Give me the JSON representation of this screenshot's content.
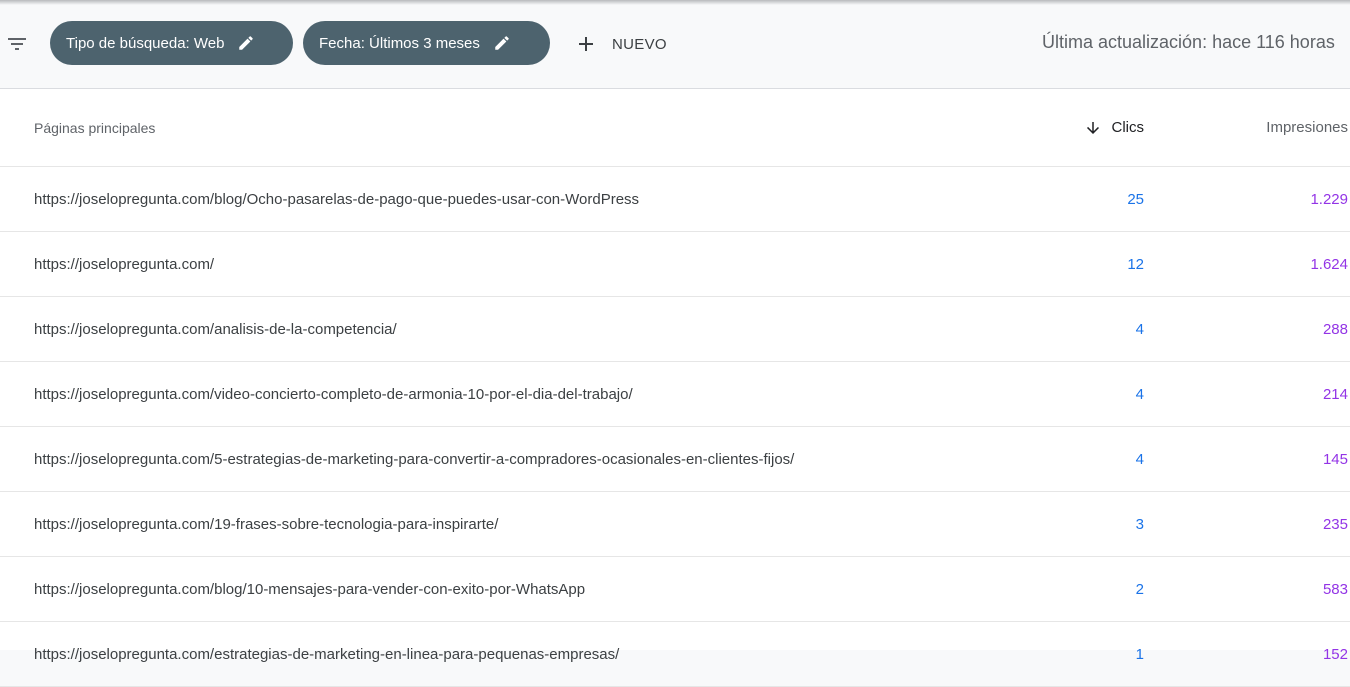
{
  "toolbar": {
    "filters": [
      {
        "label": "Tipo de búsqueda: Web"
      },
      {
        "label": "Fecha: Últimos 3 meses"
      }
    ],
    "add_label": "NUEVO",
    "last_update": "Última actualización: hace 116 horas"
  },
  "table": {
    "headers": {
      "page": "Páginas principales",
      "clicks": "Clics",
      "impressions": "Impresiones"
    },
    "sort": {
      "column": "clicks",
      "direction": "descending"
    },
    "rows": [
      {
        "url": "https://joselopregunta.com/blog/Ocho-pasarelas-de-pago-que-puedes-usar-con-WordPress",
        "clicks": "25",
        "impressions": "1.229"
      },
      {
        "url": "https://joselopregunta.com/",
        "clicks": "12",
        "impressions": "1.624"
      },
      {
        "url": "https://joselopregunta.com/analisis-de-la-competencia/",
        "clicks": "4",
        "impressions": "288"
      },
      {
        "url": "https://joselopregunta.com/video-concierto-completo-de-armonia-10-por-el-dia-del-trabajo/",
        "clicks": "4",
        "impressions": "214"
      },
      {
        "url": "https://joselopregunta.com/5-estrategias-de-marketing-para-convertir-a-compradores-ocasionales-en-clientes-fijos/",
        "clicks": "4",
        "impressions": "145"
      },
      {
        "url": "https://joselopregunta.com/19-frases-sobre-tecnologia-para-inspirarte/",
        "clicks": "3",
        "impressions": "235"
      },
      {
        "url": "https://joselopregunta.com/blog/10-mensajes-para-vender-con-exito-por-WhatsApp",
        "clicks": "2",
        "impressions": "583"
      },
      {
        "url": "https://joselopregunta.com/estrategias-de-marketing-en-linea-para-pequenas-empresas/",
        "clicks": "1",
        "impressions": "152"
      }
    ]
  },
  "colors": {
    "chip_bg": "#4d636e",
    "clicks": "#1a73e8",
    "impressions": "#9334e6",
    "toolbar_bg": "#f8f9fa"
  },
  "icons": [
    "filter-icon",
    "edit-pencil-icon",
    "plus-icon",
    "arrow-down-icon"
  ]
}
